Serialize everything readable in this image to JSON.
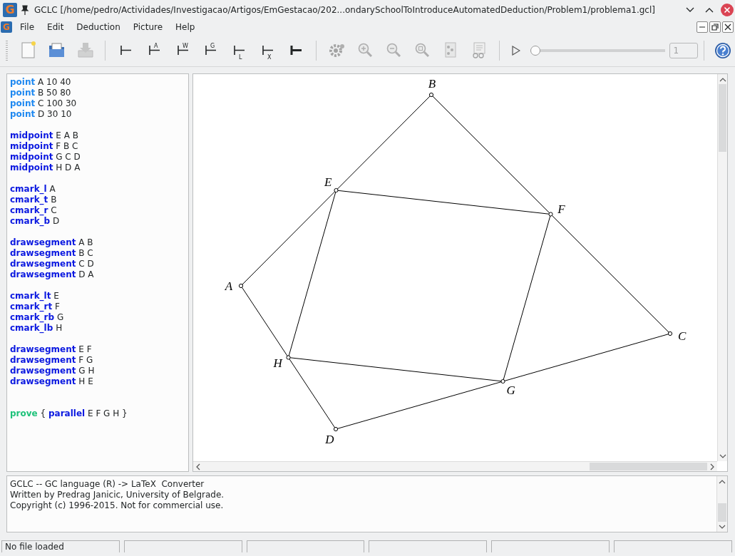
{
  "window": {
    "app_letter": "G",
    "title": "GCLC [/home/pedro/Actividades/Investigacao/Artigos/EmGestacao/202...ondarySchoolToIntroduceAutomatedDeduction/Problem1/problema1.gcl]"
  },
  "menu": {
    "app_letter": "G",
    "items": [
      "File",
      "Edit",
      "Deduction",
      "Picture",
      "Help"
    ]
  },
  "toolbar": {
    "groups": [
      [
        {
          "kind": "new",
          "disabled": false
        },
        {
          "kind": "open",
          "disabled": false
        },
        {
          "kind": "save",
          "disabled": true
        }
      ],
      [
        {
          "kind": "mark",
          "disabled": false
        },
        {
          "kind": "mark-upper",
          "caption": "A",
          "disabled": false
        },
        {
          "kind": "mark-upper",
          "caption": "W",
          "disabled": false
        },
        {
          "kind": "mark-upper",
          "caption": "G",
          "disabled": false
        },
        {
          "kind": "mark-lower",
          "caption": "L",
          "disabled": false
        },
        {
          "kind": "mark-lower",
          "caption": "X",
          "disabled": false
        },
        {
          "kind": "mark-bold",
          "disabled": false
        }
      ],
      [
        {
          "kind": "gear",
          "disabled": true
        },
        {
          "kind": "zoom-in",
          "disabled": true
        },
        {
          "kind": "zoom-out",
          "disabled": true
        },
        {
          "kind": "zoom-fit",
          "disabled": true
        },
        {
          "kind": "layers",
          "disabled": true
        },
        {
          "kind": "report",
          "disabled": true
        }
      ]
    ],
    "player": {
      "level": 0,
      "step": "1",
      "disabled": true
    }
  },
  "editor": {
    "lines": [
      {
        "kind": "declaration",
        "text": "**point** A 10 40"
      },
      {
        "kind": "declaration",
        "text": "**point** B 50 80"
      },
      {
        "kind": "declaration",
        "text": "**point** C 100 30"
      },
      {
        "kind": "declaration",
        "text": "**point** D 30 10"
      },
      {
        "kind": "blank"
      },
      {
        "kind": "command",
        "text": "**midpoint** E A B"
      },
      {
        "kind": "command",
        "text": "**midpoint** F B C"
      },
      {
        "kind": "command",
        "text": "**midpoint** G C D"
      },
      {
        "kind": "command",
        "text": "**midpoint** H D A"
      },
      {
        "kind": "blank"
      },
      {
        "kind": "command",
        "text": "**cmark_l** A"
      },
      {
        "kind": "command",
        "text": "**cmark_t** B"
      },
      {
        "kind": "command",
        "text": "**cmark_r** C"
      },
      {
        "kind": "command",
        "text": "**cmark_b** D"
      },
      {
        "kind": "blank"
      },
      {
        "kind": "command",
        "text": "**drawsegment** A B"
      },
      {
        "kind": "command",
        "text": "**drawsegment** B C"
      },
      {
        "kind": "command",
        "text": "**drawsegment** C D"
      },
      {
        "kind": "command",
        "text": "**drawsegment** D A"
      },
      {
        "kind": "blank"
      },
      {
        "kind": "command",
        "text": "**cmark_lt** E"
      },
      {
        "kind": "command",
        "text": "**cmark_rt** F"
      },
      {
        "kind": "command",
        "text": "**cmark_rb** G"
      },
      {
        "kind": "command",
        "text": "**cmark_lb** H"
      },
      {
        "kind": "blank"
      },
      {
        "kind": "command",
        "text": "**drawsegment** E F"
      },
      {
        "kind": "command",
        "text": "**drawsegment** F G"
      },
      {
        "kind": "command",
        "text": "**drawsegment** G H"
      },
      {
        "kind": "command",
        "text": "**drawsegment** H E"
      },
      {
        "kind": "blank"
      },
      {
        "kind": "blank"
      },
      {
        "kind": "proof",
        "text": "**prove** { **parallel** E F G H }"
      }
    ]
  },
  "diagram": {
    "points": [
      {
        "label": "A",
        "kind": "free"
      },
      {
        "label": "B",
        "kind": "free"
      },
      {
        "label": "C",
        "kind": "free"
      },
      {
        "label": "D",
        "kind": "free"
      },
      {
        "label": "E",
        "kind": "midpoint"
      },
      {
        "label": "F",
        "kind": "midpoint"
      },
      {
        "label": "G",
        "kind": "midpoint"
      },
      {
        "label": "H",
        "kind": "midpoint"
      }
    ]
  },
  "output": {
    "lines": [
      "GCLC -- GC language (R) -> LaTeX  Converter",
      "Written by Predrag Janicic, University of Belgrade.",
      "Copyright (c) 1996-2015. Not for commercial use."
    ]
  },
  "status_bar": {
    "text": "No file loaded"
  }
}
